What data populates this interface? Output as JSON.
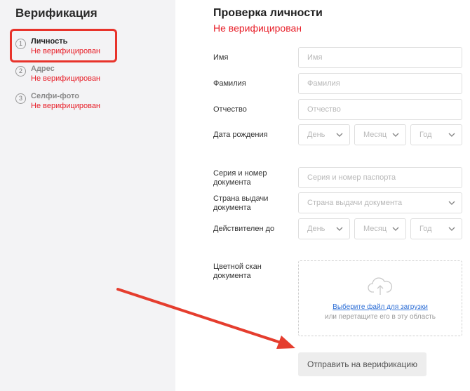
{
  "sidebar": {
    "title": "Верификация",
    "steps": [
      {
        "num": "1",
        "label": "Личность",
        "status": "Не верифицирован"
      },
      {
        "num": "2",
        "label": "Адрес",
        "status": "Не верифицирован"
      },
      {
        "num": "3",
        "label": "Селфи-фото",
        "status": "Не верифицирован"
      }
    ]
  },
  "main": {
    "title": "Проверка личности",
    "status": "Не верифицирован",
    "fields": {
      "first_name": {
        "label": "Имя",
        "placeholder": "Имя"
      },
      "last_name": {
        "label": "Фамилия",
        "placeholder": "Фамилия"
      },
      "patronymic": {
        "label": "Отчество",
        "placeholder": "Отчество"
      },
      "birth_date": {
        "label": "Дата рождения",
        "day": "День",
        "month": "Месяц",
        "year": "Год"
      },
      "passport": {
        "label": "Серия и номер документа",
        "placeholder": "Серия и номер паспорта"
      },
      "country": {
        "label": "Страна выдачи документа",
        "placeholder": "Страна выдачи документа"
      },
      "valid_until": {
        "label": "Действителен до",
        "day": "День",
        "month": "Месяц",
        "year": "Год"
      },
      "scan": {
        "label": "Цветной скан документа",
        "link": "Выберите файл для загрузки",
        "hint": "или перетащите его в эту область"
      }
    },
    "submit_label": "Отправить на верификацию"
  },
  "colors": {
    "accent_red": "#e8202a",
    "link_blue": "#2e6fd6",
    "sidebar_bg": "#f3f3f5"
  }
}
